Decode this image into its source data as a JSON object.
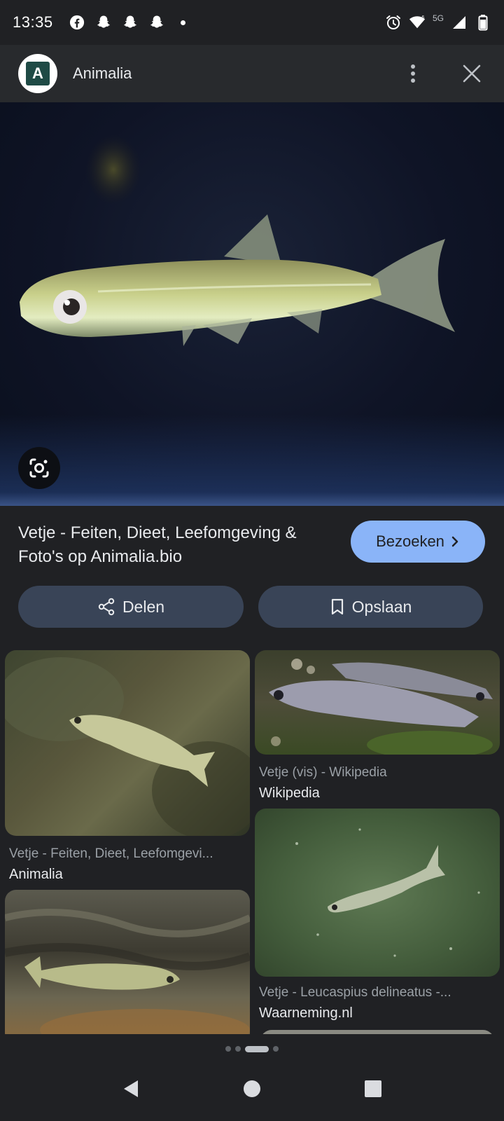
{
  "status_bar": {
    "time": "13:35",
    "left_icons": [
      "facebook-icon",
      "snapchat-icon",
      "snapchat-icon",
      "snapchat-icon",
      "dot-icon"
    ],
    "network_label": "5G",
    "right_icons": [
      "alarm-icon",
      "wifi-icon",
      "signal-icon",
      "battery-icon"
    ]
  },
  "header": {
    "logo_letter": "A",
    "title": "Animalia"
  },
  "result": {
    "title": "Vetje - Feiten, Dieet, Leefomgeving & Foto's op Animalia.bio",
    "visit_label": "Bezoeken"
  },
  "actions": {
    "share_label": "Delen",
    "save_label": "Opslaan"
  },
  "related": [
    {
      "title": "Vetje - Feiten, Dieet, Leefomgevi...",
      "source": "Animalia"
    },
    {
      "title": "Vetje (vis) - Wikipedia",
      "source": "Wikipedia"
    },
    {
      "title": "Vetje - Leucaspius delineatus -...",
      "source": "Waarneming.nl"
    }
  ],
  "colors": {
    "background": "#202124",
    "header": "#282a2d",
    "accent_button": "#8ab4f8",
    "pill_button": "#394457"
  }
}
